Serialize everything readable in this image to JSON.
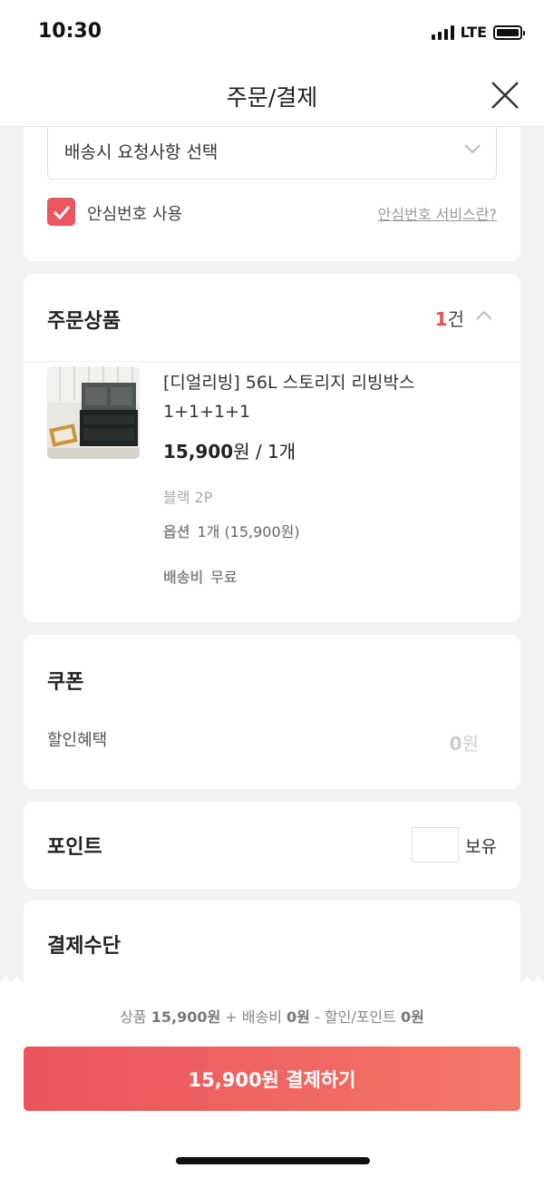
{
  "status_bar": {
    "time": "10:30",
    "network": "LTE"
  },
  "header": {
    "title": "주문/결제",
    "close_icon": "close-icon"
  },
  "delivery": {
    "request_select": "배송시 요청사항 선택",
    "safe_number_checked": true,
    "safe_number_label": "안심번호 사용",
    "safe_number_link": "안심번호 서비스란?"
  },
  "order": {
    "title": "주문상품",
    "count": "1",
    "count_unit": "건",
    "product": {
      "name": "[디얼리빙] 56L 스토리지 리빙박스 1+1+1+1",
      "price": "15,900",
      "price_unit": "원",
      "quantity": " / 1개",
      "variant": "블랙 2P",
      "option_label": "옵션",
      "option_value": "1개 (15,900원)",
      "shipping_label": "배송비",
      "shipping_value": "무료"
    }
  },
  "coupon": {
    "title": "쿠폰",
    "discount_label": "할인혜택",
    "discount_value": "0",
    "discount_unit": "원"
  },
  "point": {
    "title": "포인트",
    "holding_label": "보유"
  },
  "payment": {
    "title": "결제수단"
  },
  "summary": {
    "product_label": "상품",
    "product_amount": "15,900원",
    "plus": "+",
    "shipping_label": "배송비",
    "shipping_amount": "0원",
    "minus": "-",
    "discount_label": "할인/포인트",
    "discount_amount": "0원"
  },
  "pay_button": {
    "label": "15,900원 결제하기"
  },
  "colors": {
    "accent": "#ec5560",
    "button_start": "#ec535b",
    "button_end": "#f37868"
  }
}
